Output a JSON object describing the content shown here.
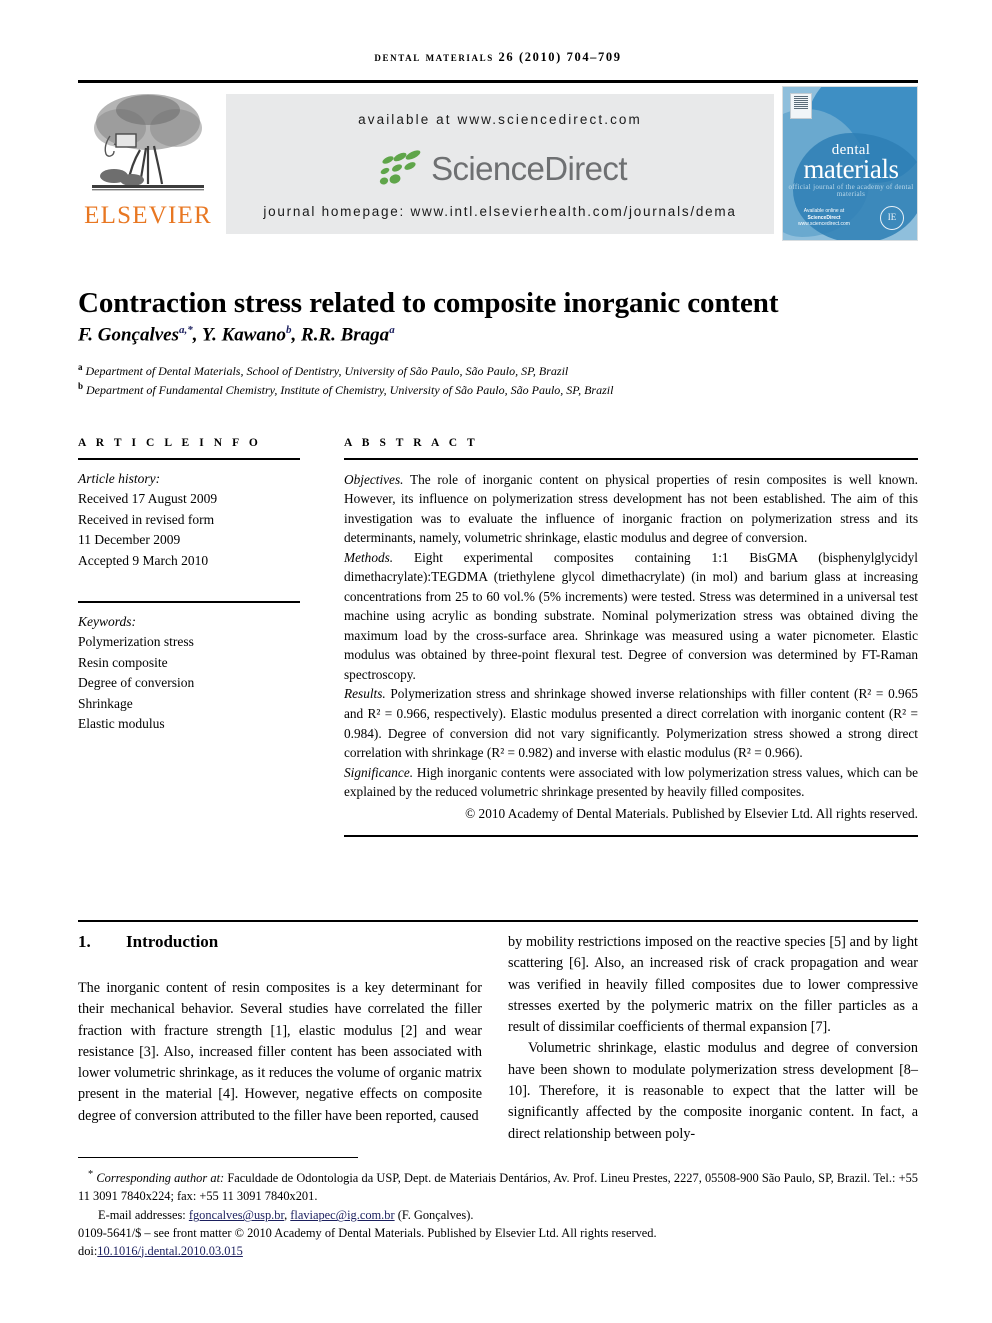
{
  "running_head": "Dental materials 26 (2010) 704–709",
  "masthead": {
    "publisher_name": "ELSEVIER",
    "available_at": "available at www.sciencedirect.com",
    "sciencedirect_word": "ScienceDirect",
    "journal_homepage": "journal homepage: www.intl.elsevierhealth.com/journals/dema",
    "cover": {
      "title_line1": "dental",
      "title_line2": "materials",
      "title_line3": "official journal of the academy of dental materials",
      "sciencedirect_badge": "Available online at",
      "sciencedirect_badge2": "ScienceDirect",
      "sciencedirect_badge3": "www.sciencedirect.com",
      "seal_text": "IE"
    },
    "colors": {
      "elsevier_orange": "#E87722",
      "sciencedirect_green": "#5FA54A",
      "sciencedirect_gray": "#6e7072",
      "banner_gray": "#e8e9ea",
      "cover_blue_light": "#8fbfdc",
      "cover_blue_mid": "#6aa9cf",
      "cover_blue_dark": "#2e7fb5"
    }
  },
  "article": {
    "title": "Contraction stress related to composite inorganic content",
    "authors_plain": "F. Gonçalves",
    "author1": "F. Gonçalves",
    "author1_sup": "a,*",
    "author2": "Y. Kawano",
    "author2_sup": "b",
    "author3": "R.R. Braga",
    "author3_sup": "a",
    "affiliation_a_marker": "a",
    "affiliation_a": "Department of Dental Materials, School of Dentistry, University of São Paulo, São Paulo, SP, Brazil",
    "affiliation_b_marker": "b",
    "affiliation_b": "Department of Fundamental Chemistry, Institute of Chemistry, University of São Paulo, São Paulo, SP, Brazil"
  },
  "article_info": {
    "heading": "A R T I C L E   I N F O",
    "history_label": "Article history:",
    "history": [
      "Received 17 August 2009",
      "Received in revised form",
      "11 December 2009",
      "Accepted 9 March 2010"
    ],
    "keywords_label": "Keywords:",
    "keywords": [
      "Polymerization stress",
      "Resin composite",
      "Degree of conversion",
      "Shrinkage",
      "Elastic modulus"
    ]
  },
  "abstract": {
    "heading": "A B S T R A C T",
    "objectives_label": "Objectives.",
    "objectives_text": " The role of inorganic content on physical properties of resin composites is well known. However, its influence on polymerization stress development has not been established. The aim of this investigation was to evaluate the influence of inorganic fraction on polymerization stress and its determinants, namely, volumetric shrinkage, elastic modulus and degree of conversion.",
    "methods_label": "Methods.",
    "methods_text": " Eight experimental composites containing 1:1 BisGMA (bisphenylglycidyl dimethacrylate):TEGDMA (triethylene glycol dimethacrylate) (in mol) and barium glass at increasing concentrations from 25 to 60 vol.% (5% increments) were tested. Stress was determined in a universal test machine using acrylic as bonding substrate. Nominal polymerization stress was obtained diving the maximum load by the cross-surface area. Shrinkage was measured using a water picnometer. Elastic modulus was obtained by three-point flexural test. Degree of conversion was determined by FT-Raman spectroscopy.",
    "results_label": "Results.",
    "results_text": " Polymerization stress and shrinkage showed inverse relationships with filler content (R² = 0.965 and R² = 0.966, respectively). Elastic modulus presented a direct correlation with inorganic content (R² = 0.984). Degree of conversion did not vary significantly. Polymerization stress showed a strong direct correlation with shrinkage (R² = 0.982) and inverse with elastic modulus (R² = 0.966).",
    "significance_label": "Significance.",
    "significance_text": " High inorganic contents were associated with low polymerization stress values, which can be explained by the reduced volumetric shrinkage presented by heavily filled composites.",
    "copyright": "© 2010 Academy of Dental Materials. Published by Elsevier Ltd. All rights reserved."
  },
  "introduction": {
    "number": "1.",
    "heading": "Introduction",
    "left_para": "The inorganic content of resin composites is a key determinant for their mechanical behavior. Several studies have correlated the filler fraction with fracture strength [1], elastic modulus [2] and wear resistance [3]. Also, increased filler content has been associated with lower volumetric shrinkage, as it reduces the volume of organic matrix present in the material [4]. However, negative effects on composite degree of conversion attributed to the filler have been reported, caused",
    "right_para1": "by mobility restrictions imposed on the reactive species [5] and by light scattering [6]. Also, an increased risk of crack propagation and wear was verified in heavily filled composites due to lower compressive stresses exerted by the polymeric matrix on the filler particles as a result of dissimilar coefficients of thermal expansion [7].",
    "right_para2": "Volumetric shrinkage, elastic modulus and degree of conversion have been shown to modulate polymerization stress development [8–10]. Therefore, it is reasonable to expect that the latter will be significantly affected by the composite inorganic content. In fact, a direct relationship between poly-"
  },
  "footnotes": {
    "corresponding_marker": "*",
    "corresponding_label": "Corresponding author at:",
    "corresponding_text": " Faculdade de Odontologia da USP, Dept. de Materiais Dentários, Av. Prof. Lineu Prestes, 2227, 05508-900 São Paulo, SP, Brazil. Tel.: +55 11 3091 7840x224; fax: +55 11 3091 7840x201.",
    "email_label": "E-mail addresses:",
    "email1": "fgoncalves@usp.br",
    "email2": "flaviapec@ig.com.br",
    "email_suffix": " (F. Gonçalves).",
    "front_matter": "0109-5641/$ – see front matter © 2010 Academy of Dental Materials. Published by Elsevier Ltd. All rights reserved.",
    "doi_label": "doi:",
    "doi_value": "10.1016/j.dental.2010.03.015"
  }
}
